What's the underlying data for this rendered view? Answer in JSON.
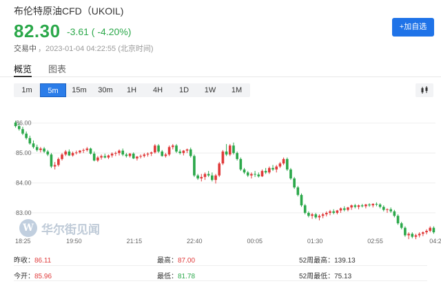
{
  "header": {
    "title": "布伦特原油CFD（UKOIL)",
    "price": "82.30",
    "change": "-3.61 ( -4.20%)",
    "status_label": "交易中",
    "timestamp": "，2023-01-04 04:22:55 (北京时间)",
    "add_button": "+加自选"
  },
  "tabs": [
    {
      "label": "概览",
      "active": true
    },
    {
      "label": "图表",
      "active": false
    }
  ],
  "ranges": [
    {
      "label": "1m"
    },
    {
      "label": "5m",
      "active": true
    },
    {
      "label": "15m"
    },
    {
      "label": "30m"
    },
    {
      "label": "1H"
    },
    {
      "label": "4H"
    },
    {
      "label": "1D"
    },
    {
      "label": "1W"
    },
    {
      "label": "1M"
    }
  ],
  "watermark": "华尔街见闻",
  "stats": {
    "prev_close_label": "昨收：",
    "prev_close": "86.11",
    "open_label": "今开：",
    "open": "85.96",
    "high_label": "最高：",
    "high": "87.00",
    "low_label": "最低：",
    "low": "81.78",
    "week52_high_label": "52周最高：",
    "week52_high": "139.13",
    "week52_low_label": "52周最低：",
    "week52_low": "75.13"
  },
  "colors": {
    "up": "#e03a3a",
    "down": "#2ba84a",
    "accent": "#1f73e8"
  },
  "chart_data": {
    "type": "candlestick",
    "y_ticks": [
      "86.00",
      "85.00",
      "84.00",
      "83.00"
    ],
    "x_ticks": [
      "18:25",
      "19:50",
      "21:15",
      "22:40",
      "00:05",
      "01:30",
      "02:55",
      "04:2"
    ],
    "ylim": [
      82.1,
      86.2
    ],
    "candles": [
      [
        86.02,
        86.08,
        85.85,
        85.9
      ],
      [
        85.9,
        85.98,
        85.75,
        85.8
      ],
      [
        85.8,
        85.88,
        85.6,
        85.65
      ],
      [
        85.65,
        85.72,
        85.45,
        85.5
      ],
      [
        85.5,
        85.58,
        85.28,
        85.32
      ],
      [
        85.32,
        85.42,
        85.15,
        85.2
      ],
      [
        85.2,
        85.28,
        85.05,
        85.1
      ],
      [
        85.1,
        85.2,
        85.02,
        85.15
      ],
      [
        85.15,
        85.2,
        85.0,
        85.05
      ],
      [
        85.05,
        85.1,
        84.9,
        84.95
      ],
      [
        84.95,
        85.0,
        84.5,
        84.55
      ],
      [
        84.55,
        84.7,
        84.45,
        84.6
      ],
      [
        84.6,
        84.85,
        84.55,
        84.8
      ],
      [
        84.8,
        85.0,
        84.75,
        84.95
      ],
      [
        84.95,
        85.1,
        84.9,
        85.05
      ],
      [
        85.05,
        85.12,
        84.9,
        84.92
      ],
      [
        84.92,
        85.05,
        84.88,
        85.0
      ],
      [
        85.0,
        85.08,
        84.95,
        85.02
      ],
      [
        85.02,
        85.1,
        84.98,
        85.08
      ],
      [
        85.08,
        85.15,
        85.0,
        85.1
      ],
      [
        85.1,
        85.2,
        85.05,
        85.15
      ],
      [
        85.15,
        85.18,
        84.95,
        84.98
      ],
      [
        84.98,
        85.05,
        84.72,
        84.75
      ],
      [
        84.75,
        84.9,
        84.7,
        84.85
      ],
      [
        84.85,
        84.95,
        84.78,
        84.9
      ],
      [
        84.9,
        84.98,
        84.82,
        84.85
      ],
      [
        84.85,
        84.95,
        84.8,
        84.92
      ],
      [
        84.92,
        85.02,
        84.85,
        84.98
      ],
      [
        84.98,
        85.05,
        84.9,
        85.0
      ],
      [
        85.0,
        85.12,
        84.92,
        85.08
      ],
      [
        85.08,
        85.15,
        84.9,
        84.95
      ],
      [
        84.95,
        85.0,
        84.85,
        84.9
      ],
      [
        84.9,
        85.0,
        84.85,
        84.98
      ],
      [
        84.98,
        85.02,
        84.8,
        84.82
      ],
      [
        84.82,
        84.9,
        84.75,
        84.88
      ],
      [
        84.88,
        84.95,
        84.82,
        84.9
      ],
      [
        84.9,
        85.0,
        84.85,
        84.95
      ],
      [
        84.95,
        85.02,
        84.88,
        84.98
      ],
      [
        84.98,
        85.05,
        84.9,
        85.02
      ],
      [
        85.02,
        85.3,
        84.98,
        85.25
      ],
      [
        85.25,
        85.3,
        85.0,
        85.05
      ],
      [
        85.05,
        85.1,
        84.88,
        84.9
      ],
      [
        84.9,
        85.0,
        84.85,
        84.95
      ],
      [
        84.95,
        85.25,
        84.9,
        85.2
      ],
      [
        85.2,
        85.3,
        85.12,
        85.25
      ],
      [
        85.25,
        85.3,
        85.0,
        85.05
      ],
      [
        85.05,
        85.12,
        84.95,
        85.0
      ],
      [
        85.0,
        85.1,
        84.92,
        85.08
      ],
      [
        85.08,
        85.15,
        85.0,
        85.12
      ],
      [
        85.12,
        85.18,
        84.85,
        84.9
      ],
      [
        84.9,
        84.95,
        84.2,
        84.25
      ],
      [
        84.25,
        84.3,
        84.1,
        84.15
      ],
      [
        84.15,
        84.3,
        84.05,
        84.2
      ],
      [
        84.2,
        84.35,
        84.1,
        84.3
      ],
      [
        84.3,
        84.4,
        84.2,
        84.25
      ],
      [
        84.25,
        84.35,
        84.05,
        84.1
      ],
      [
        84.1,
        84.3,
        83.98,
        84.25
      ],
      [
        84.25,
        84.7,
        84.2,
        84.65
      ],
      [
        84.65,
        85.1,
        84.6,
        85.05
      ],
      [
        85.05,
        85.3,
        84.9,
        84.95
      ],
      [
        84.95,
        85.3,
        84.9,
        85.25
      ],
      [
        85.25,
        85.35,
        84.95,
        85.0
      ],
      [
        85.0,
        85.05,
        84.75,
        84.8
      ],
      [
        84.8,
        84.85,
        84.4,
        84.45
      ],
      [
        84.45,
        84.5,
        84.3,
        84.35
      ],
      [
        84.35,
        84.4,
        84.2,
        84.25
      ],
      [
        84.25,
        84.35,
        84.15,
        84.3
      ],
      [
        84.3,
        84.4,
        84.2,
        84.28
      ],
      [
        84.28,
        84.35,
        84.18,
        84.22
      ],
      [
        84.22,
        84.45,
        84.2,
        84.4
      ],
      [
        84.4,
        84.5,
        84.3,
        84.35
      ],
      [
        84.35,
        84.55,
        84.3,
        84.5
      ],
      [
        84.5,
        84.6,
        84.4,
        84.45
      ],
      [
        84.45,
        84.6,
        84.35,
        84.55
      ],
      [
        84.55,
        84.7,
        84.5,
        84.65
      ],
      [
        84.65,
        84.85,
        84.6,
        84.8
      ],
      [
        84.8,
        84.85,
        84.4,
        84.45
      ],
      [
        84.45,
        84.5,
        84.1,
        84.15
      ],
      [
        84.15,
        84.2,
        83.8,
        83.85
      ],
      [
        83.85,
        83.9,
        83.55,
        83.6
      ],
      [
        83.6,
        83.65,
        83.2,
        83.25
      ],
      [
        83.25,
        83.3,
        82.95,
        83.0
      ],
      [
        83.0,
        83.05,
        82.85,
        82.9
      ],
      [
        82.9,
        83.0,
        82.8,
        82.95
      ],
      [
        82.95,
        83.0,
        82.8,
        82.85
      ],
      [
        82.85,
        82.95,
        82.75,
        82.9
      ],
      [
        82.9,
        83.0,
        82.82,
        82.95
      ],
      [
        82.95,
        83.05,
        82.88,
        83.0
      ],
      [
        83.0,
        83.1,
        82.92,
        83.05
      ],
      [
        83.05,
        83.12,
        82.95,
        83.0
      ],
      [
        83.0,
        83.1,
        82.95,
        83.08
      ],
      [
        83.08,
        83.18,
        83.0,
        83.15
      ],
      [
        83.15,
        83.22,
        83.05,
        83.1
      ],
      [
        83.1,
        83.2,
        83.05,
        83.18
      ],
      [
        83.18,
        83.28,
        83.1,
        83.25
      ],
      [
        83.25,
        83.3,
        83.15,
        83.2
      ],
      [
        83.2,
        83.28,
        83.12,
        83.25
      ],
      [
        83.25,
        83.3,
        83.18,
        83.22
      ],
      [
        83.22,
        83.3,
        83.15,
        83.28
      ],
      [
        83.28,
        83.32,
        83.2,
        83.25
      ],
      [
        83.25,
        83.32,
        83.18,
        83.3
      ],
      [
        83.3,
        83.35,
        83.22,
        83.28
      ],
      [
        83.28,
        83.32,
        83.15,
        83.2
      ],
      [
        83.2,
        83.25,
        83.05,
        83.1
      ],
      [
        83.1,
        83.15,
        83.0,
        83.12
      ],
      [
        83.12,
        83.18,
        83.0,
        83.05
      ],
      [
        83.05,
        83.1,
        82.85,
        82.9
      ],
      [
        82.9,
        82.95,
        82.6,
        82.65
      ],
      [
        82.65,
        82.7,
        82.45,
        82.5
      ],
      [
        82.5,
        82.55,
        82.2,
        82.25
      ],
      [
        82.25,
        82.35,
        82.12,
        82.3
      ],
      [
        82.3,
        82.35,
        82.15,
        82.2
      ],
      [
        82.2,
        82.3,
        82.12,
        82.25
      ],
      [
        82.25,
        82.35,
        82.18,
        82.3
      ],
      [
        82.3,
        82.38,
        82.22,
        82.35
      ],
      [
        82.35,
        82.45,
        82.28,
        82.4
      ],
      [
        82.4,
        82.55,
        82.35,
        82.5
      ],
      [
        82.5,
        82.55,
        82.3,
        82.35
      ]
    ]
  }
}
